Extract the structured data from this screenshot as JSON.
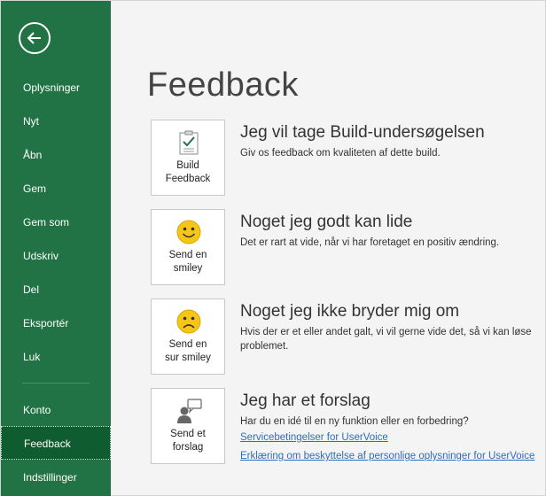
{
  "sidebar": {
    "items": [
      {
        "label": "Oplysninger"
      },
      {
        "label": "Nyt"
      },
      {
        "label": "Åbn"
      },
      {
        "label": "Gem"
      },
      {
        "label": "Gem som"
      },
      {
        "label": "Udskriv"
      },
      {
        "label": "Del"
      },
      {
        "label": "Eksportér"
      },
      {
        "label": "Luk"
      },
      {
        "label": "Konto"
      },
      {
        "label": "Feedback"
      },
      {
        "label": "Indstillinger"
      }
    ],
    "active": "Feedback"
  },
  "main": {
    "title": "Feedback",
    "options": [
      {
        "icon": "survey-checklist-icon",
        "button_label": "Build\nFeedback",
        "title": "Jeg vil tage Build-undersøgelsen",
        "description": "Giv os feedback om kvaliteten af dette build."
      },
      {
        "icon": "smiley-icon",
        "button_label": "Send en\nsmiley",
        "title": "Noget jeg godt kan lide",
        "description": "Det er rart at vide, når vi har foretaget en positiv ændring."
      },
      {
        "icon": "frown-icon",
        "button_label": "Send en\nsur smiley",
        "title": "Noget jeg ikke bryder mig om",
        "description": "Hvis der er et eller andet galt, vi vil gerne vide det, så vi kan løse problemet."
      },
      {
        "icon": "person-suggestion-icon",
        "button_label": "Send et\nforslag",
        "title": "Jeg har et forslag",
        "description": "Har du en idé til en ny funktion eller en forbedring?",
        "links": [
          "Servicebetingelser for UserVoice",
          "Erklæring om beskyttelse af personlige oplysninger for UserVoice"
        ]
      }
    ]
  },
  "colors": {
    "sidebar": "#217346",
    "sidebar_active": "#0e5c2f",
    "link": "#2b6fc0",
    "smiley": "#f5c518"
  }
}
